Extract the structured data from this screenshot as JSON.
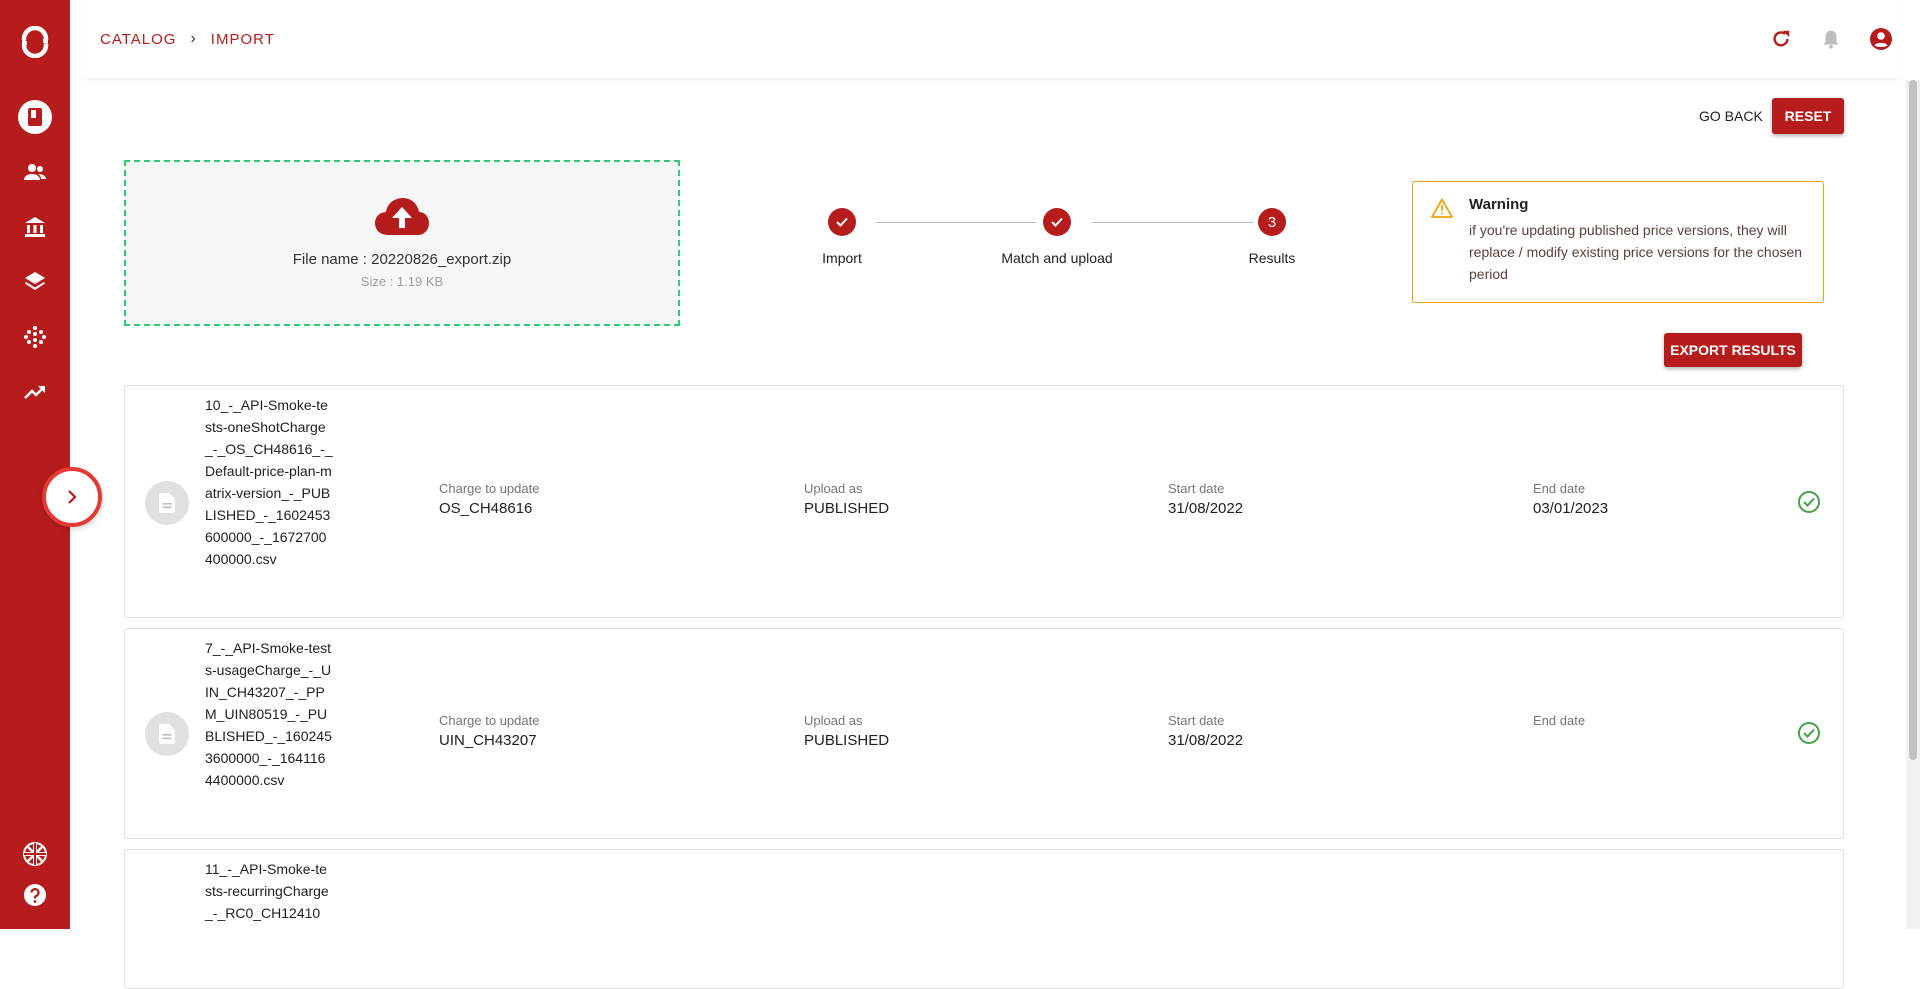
{
  "breadcrumb": {
    "catalog": "CATALOG",
    "separator": "›",
    "import": "IMPORT"
  },
  "sidebar": {
    "items": [
      "logo-icon",
      "catalog-book-icon",
      "users-icon",
      "bank-icon",
      "layers-icon",
      "dots-grid-icon",
      "trending-icon"
    ],
    "bottom_items": [
      "language-uk-flag-icon",
      "help-icon"
    ]
  },
  "topbar": {
    "icons": [
      "refresh-icon",
      "bell-icon",
      "account-icon"
    ]
  },
  "actions": {
    "go_back": "GO BACK",
    "reset": "RESET",
    "export_results": "EXPORT RESULTS"
  },
  "dropzone": {
    "file_name": "File name : 20220826_export.zip",
    "size": "Size : 1.19 KB"
  },
  "stepper": {
    "steps": [
      {
        "label": "Import",
        "state": "done",
        "number": ""
      },
      {
        "label": "Match and upload",
        "state": "done",
        "number": ""
      },
      {
        "label": "Results",
        "state": "active",
        "number": "3"
      }
    ]
  },
  "warning": {
    "title": "Warning",
    "text": "if you're updating published price versions, they will replace / modify existing price versions for the chosen period"
  },
  "results": {
    "labels": {
      "charge": "Charge to update",
      "upload": "Upload as",
      "start": "Start date",
      "end": "End date"
    },
    "items": [
      {
        "file": "10_-_API-Smoke-tests-oneShotCharge_-_OS_CH48616_-_Default-price-plan-matrix-version_-_PUBLISHED_-_1602453600000_-_1672700400000.csv",
        "charge": "OS_CH48616",
        "upload_as": "PUBLISHED",
        "start_date": "31/08/2022",
        "end_date": "03/01/2023"
      },
      {
        "file": "7_-_API-Smoke-tests-usageCharge_-_UIN_CH43207_-_PPM_UIN80519_-_PUBLISHED_-_1602453600000_-_1641164400000.csv",
        "charge": "UIN_CH43207",
        "upload_as": "PUBLISHED",
        "start_date": "31/08/2022",
        "end_date": ""
      },
      {
        "file": "11_-_API-Smoke-tests-recurringCharge_-_RC0_CH12410"
      }
    ]
  },
  "colors": {
    "brand": "#b71c1c",
    "success": "#43a047",
    "warning_border": "#f0a30a",
    "dropzone_border": "#2ecc71"
  }
}
